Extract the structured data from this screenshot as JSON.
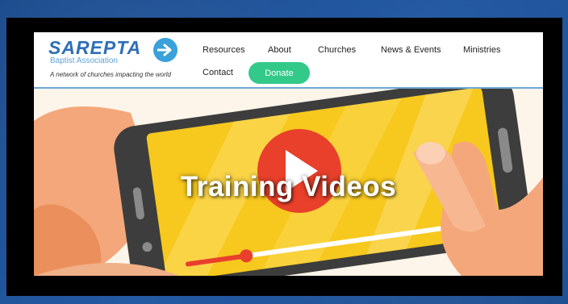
{
  "logo": {
    "title": "SAREPTA",
    "subtitle": "Baptist Association",
    "tagline": "A network of churches impacting the world",
    "icon": "arrow-right-icon"
  },
  "nav": {
    "resources": "Resources",
    "about": "About",
    "churches": "Churches",
    "news_events": "News & Events",
    "ministries": "Ministries",
    "contact": "Contact",
    "donate": "Donate"
  },
  "hero": {
    "title": "Training Videos",
    "video_progress": 0.2,
    "icon": "play-icon"
  },
  "colors": {
    "brand_blue": "#2f6fb7",
    "donate_green": "#33c989",
    "screen_yellow": "#f7c81e",
    "play_red": "#e8402a",
    "frame_blue": "#1c4f93"
  }
}
